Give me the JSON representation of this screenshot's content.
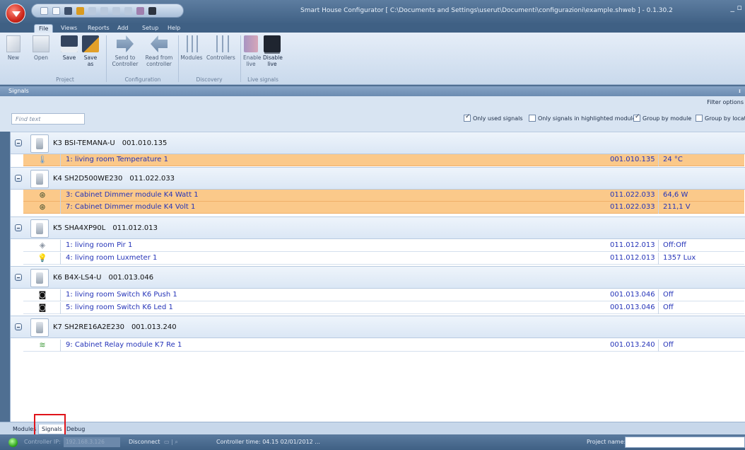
{
  "window": {
    "title": "Smart House Configurator [ C:\\Documents and Settings\\userut\\Documenti\\configurazioni\\example.shweb ] - 0.1.30.2"
  },
  "ribbon_tabs": [
    "File",
    "Views",
    "Reports",
    "Add",
    "Setup",
    "Help"
  ],
  "ribbon": {
    "buttons": [
      {
        "label": "New",
        "icon": "new-document-icon"
      },
      {
        "label": "Open",
        "icon": "open-folder-icon"
      },
      {
        "label": "Save",
        "icon": "floppy-disk-icon"
      },
      {
        "label": "Save as",
        "icon": "save-as-icon"
      },
      {
        "label": "Send to Controller",
        "icon": "send-arrow-icon"
      },
      {
        "label": "Read from controller",
        "icon": "read-arrow-icon"
      },
      {
        "label": "Modules",
        "icon": "modules-network-icon"
      },
      {
        "label": "Controllers",
        "icon": "controllers-network-icon"
      },
      {
        "label": "Enable live",
        "icon": "enable-live-icon"
      },
      {
        "label": "Disable live",
        "icon": "monitor-icon"
      }
    ],
    "groups": [
      "Project",
      "Configuration",
      "Discovery",
      "Live signals"
    ]
  },
  "panel": {
    "title": "Signals",
    "pin": "ᵻ"
  },
  "filters": {
    "filter_options": "Filter options",
    "find_placeholder": "Find text",
    "only_used_signals": "Only used signals",
    "only_highlighted": "Only signals in highlighted modules",
    "group_by_module": "Group by module",
    "group_by_location": "Group by location"
  },
  "modules": [
    {
      "name": "K3 BSI-TEMANA-U",
      "address": "001.010.135",
      "signals": [
        {
          "name": "1: living room Temperature 1",
          "address": "001.010.135",
          "value": "24 °C",
          "highlight": true,
          "icon": "thermometer-icon"
        }
      ]
    },
    {
      "name": "K4 SH2D500WE230",
      "address": "011.022.033",
      "signals": [
        {
          "name": "3: Cabinet Dimmer module K4 Watt 1",
          "address": "011.022.033",
          "value": "64,6 W",
          "highlight": true,
          "icon": "watt-meter-icon"
        },
        {
          "name": "7: Cabinet Dimmer module K4 Volt 1",
          "address": "011.022.033",
          "value": "211,1 V",
          "highlight": true,
          "icon": "volt-meter-icon"
        }
      ]
    },
    {
      "name": "K5 SHA4XP90L",
      "address": "011.012.013",
      "signals": [
        {
          "name": "1:  living room Pir 1",
          "address": "011.012.013",
          "value": "Off:Off",
          "highlight": false,
          "icon": "pir-sensor-icon"
        },
        {
          "name": "4: living room Luxmeter 1",
          "address": "011.012.013",
          "value": "1357 Lux",
          "highlight": false,
          "icon": "lamp-icon"
        }
      ]
    },
    {
      "name": "K6 B4X-LS4-U",
      "address": "001.013.046",
      "signals": [
        {
          "name": "1: living room Switch K6 Push 1",
          "address": "001.013.046",
          "value": "Off",
          "highlight": false,
          "icon": "push-button-icon"
        },
        {
          "name": "5: living room Switch K6 Led 1",
          "address": "001.013.046",
          "value": "Off",
          "highlight": false,
          "icon": "led-icon"
        }
      ]
    },
    {
      "name": "K7 SH2RE16A2E230",
      "address": "001.013.240",
      "signals": [
        {
          "name": "9: Cabinet Relay module K7 Re 1",
          "address": "001.013.240",
          "value": "Off",
          "highlight": false,
          "icon": "relay-icon"
        }
      ]
    }
  ],
  "bottom_tabs": [
    "Modules",
    "Signals",
    "Debug"
  ],
  "status": {
    "controller_ip_label": "Controller IP:",
    "controller_ip": "192.168.3.126",
    "disconnect": "Disconnect",
    "controller_time": "Controller time: 04.15  02/01/2012 ...",
    "project_name_label": "Project name:"
  },
  "colors": {
    "highlight_row": "#fbc98a",
    "signal_text": "#2433b8",
    "status_ok": "#2ea51c",
    "red_marker": "#e0141a"
  }
}
